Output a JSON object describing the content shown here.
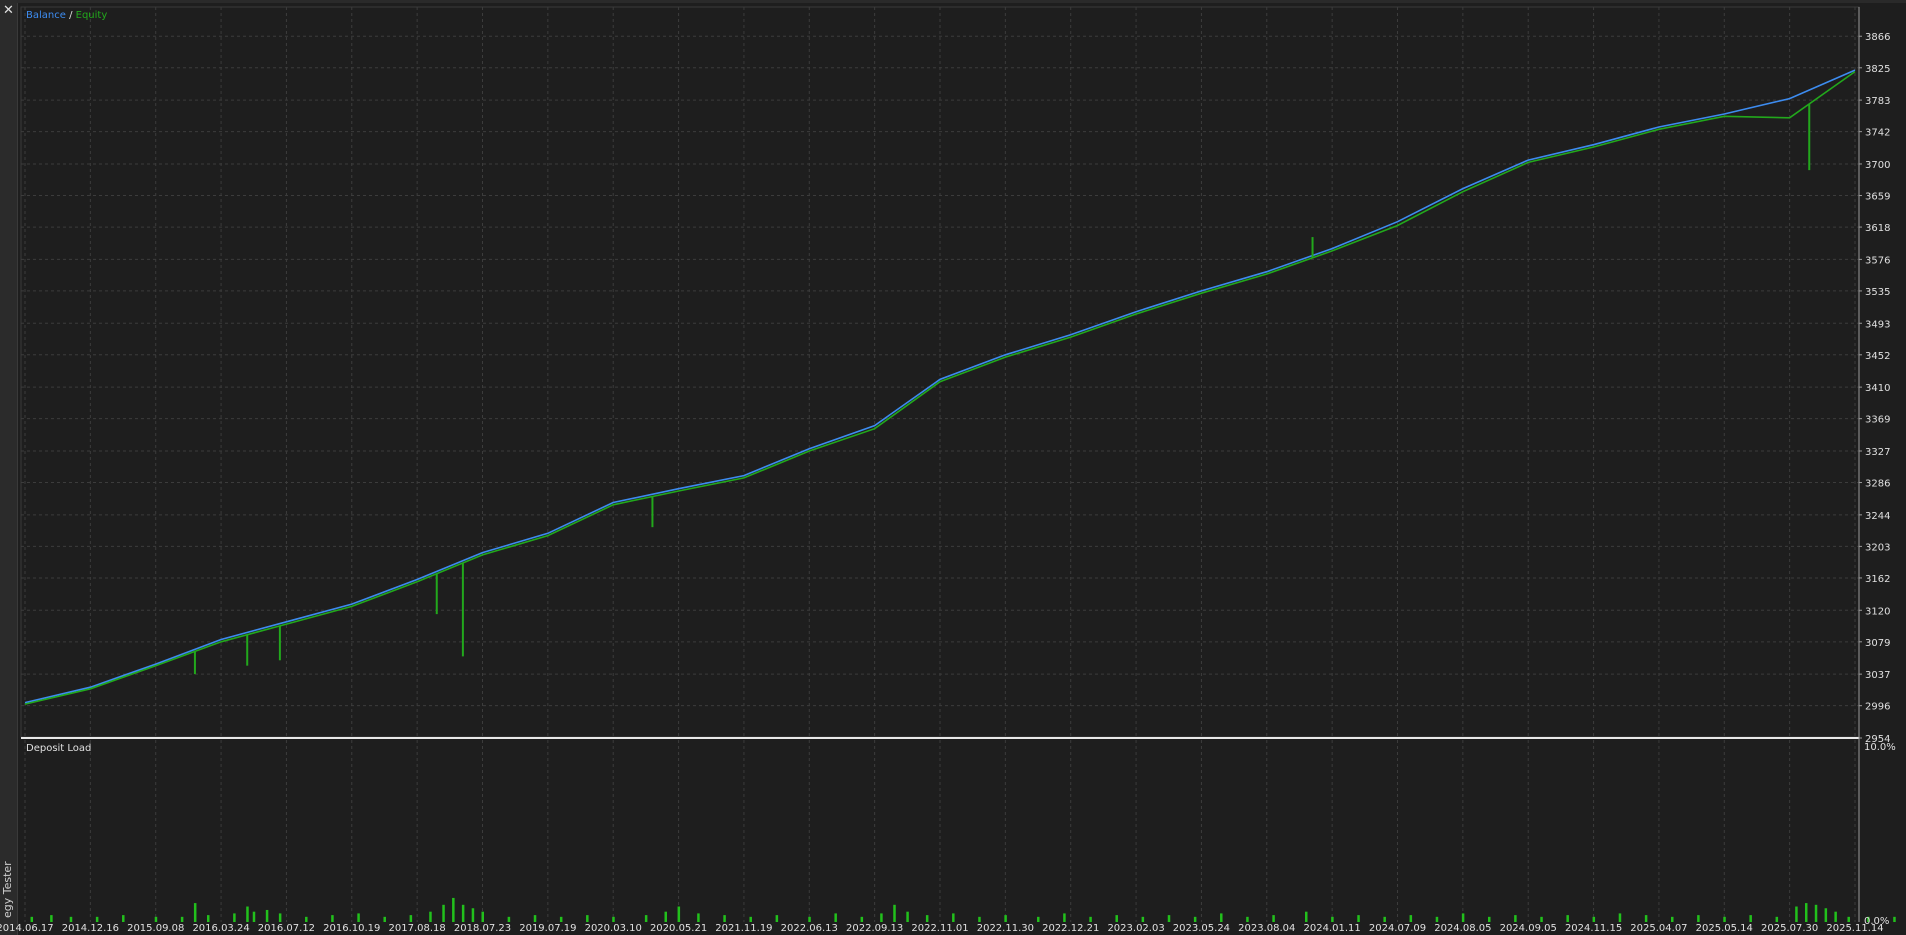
{
  "window": {
    "close_icon": "close-icon",
    "side_label": "egy Tester"
  },
  "colors": {
    "background": "#1e1e1e",
    "grid": "#3c3c3c",
    "balance": "#3d8cf0",
    "equity": "#22a81c",
    "deposit_load": "#22c01c",
    "text": "#e0e0e0",
    "separator": "#e8e8e8"
  },
  "chart_data": [
    {
      "type": "line",
      "legend": {
        "balance": "Balance",
        "separator": " / ",
        "equity": "Equity",
        "position": "top-left"
      },
      "x": [
        "2014.06.17",
        "2014.12.16",
        "2015.09.08",
        "2016.03.24",
        "2016.07.12",
        "2016.10.19",
        "2017.08.18",
        "2018.07.23",
        "2019.07.19",
        "2020.03.10",
        "2020.05.21",
        "2021.11.19",
        "2022.06.13",
        "2022.09.13",
        "2022.11.01",
        "2022.11.30",
        "2022.12.21",
        "2023.02.03",
        "2023.05.24",
        "2023.08.04",
        "2024.01.11",
        "2024.07.09",
        "2024.08.05",
        "2024.09.05",
        "2024.11.15",
        "2025.04.07",
        "2025.05.14",
        "2025.07.30",
        "2025.11.14"
      ],
      "y_ticks": [
        2954,
        2996,
        3037,
        3079,
        3120,
        3162,
        3203,
        3244,
        3286,
        3327,
        3369,
        3410,
        3452,
        3493,
        3535,
        3576,
        3618,
        3659,
        3700,
        3742,
        3783,
        3825,
        3866
      ],
      "ylim": [
        2954,
        3904
      ],
      "grid": true,
      "series": [
        {
          "name": "Balance",
          "values": [
            3000,
            3020,
            3050,
            3082,
            3105,
            3128,
            3160,
            3195,
            3220,
            3260,
            3278,
            3295,
            3330,
            3360,
            3420,
            3452,
            3478,
            3508,
            3535,
            3560,
            3590,
            3625,
            3668,
            3705,
            3725,
            3748,
            3765,
            3785,
            3822
          ]
        },
        {
          "name": "Equity",
          "values": [
            2998,
            3018,
            3048,
            3079,
            3102,
            3125,
            3157,
            3192,
            3217,
            3257,
            3275,
            3292,
            3327,
            3356,
            3417,
            3449,
            3475,
            3505,
            3532,
            3557,
            3587,
            3620,
            3664,
            3702,
            3722,
            3745,
            3762,
            3760,
            3820
          ],
          "drawdowns": [
            {
              "at": 2.6,
              "low": 3037
            },
            {
              "at": 3.4,
              "low": 3048
            },
            {
              "at": 3.9,
              "low": 3055
            },
            {
              "at": 6.3,
              "low": 3115
            },
            {
              "at": 6.7,
              "low": 3060
            },
            {
              "at": 9.6,
              "low": 3228
            },
            {
              "at": 19.7,
              "low": 3605
            },
            {
              "at": 27.3,
              "low": 3692
            }
          ]
        }
      ]
    },
    {
      "type": "bar",
      "title": "Deposit Load",
      "y_ticks": [
        "10.0%",
        "0.0%"
      ],
      "ylim": [
        0,
        10
      ],
      "bars": [
        {
          "at": 0.1,
          "value": 0.3
        },
        {
          "at": 0.4,
          "value": 0.4
        },
        {
          "at": 0.7,
          "value": 0.3
        },
        {
          "at": 1.1,
          "value": 0.3
        },
        {
          "at": 1.5,
          "value": 0.4
        },
        {
          "at": 2.0,
          "value": 0.3
        },
        {
          "at": 2.4,
          "value": 0.3
        },
        {
          "at": 2.6,
          "value": 1.1
        },
        {
          "at": 2.8,
          "value": 0.4
        },
        {
          "at": 3.2,
          "value": 0.5
        },
        {
          "at": 3.4,
          "value": 0.9
        },
        {
          "at": 3.5,
          "value": 0.6
        },
        {
          "at": 3.7,
          "value": 0.7
        },
        {
          "at": 3.9,
          "value": 0.5
        },
        {
          "at": 4.3,
          "value": 0.3
        },
        {
          "at": 4.7,
          "value": 0.4
        },
        {
          "at": 5.1,
          "value": 0.5
        },
        {
          "at": 5.5,
          "value": 0.3
        },
        {
          "at": 5.9,
          "value": 0.4
        },
        {
          "at": 6.2,
          "value": 0.6
        },
        {
          "at": 6.4,
          "value": 1.0
        },
        {
          "at": 6.55,
          "value": 1.4
        },
        {
          "at": 6.7,
          "value": 1.0
        },
        {
          "at": 6.85,
          "value": 0.8
        },
        {
          "at": 7.0,
          "value": 0.6
        },
        {
          "at": 7.4,
          "value": 0.3
        },
        {
          "at": 7.8,
          "value": 0.4
        },
        {
          "at": 8.2,
          "value": 0.3
        },
        {
          "at": 8.6,
          "value": 0.4
        },
        {
          "at": 9.0,
          "value": 0.3
        },
        {
          "at": 9.5,
          "value": 0.4
        },
        {
          "at": 9.8,
          "value": 0.6
        },
        {
          "at": 10.0,
          "value": 0.9
        },
        {
          "at": 10.3,
          "value": 0.5
        },
        {
          "at": 10.7,
          "value": 0.4
        },
        {
          "at": 11.1,
          "value": 0.3
        },
        {
          "at": 11.5,
          "value": 0.4
        },
        {
          "at": 12.0,
          "value": 0.3
        },
        {
          "at": 12.4,
          "value": 0.5
        },
        {
          "at": 12.8,
          "value": 0.3
        },
        {
          "at": 13.1,
          "value": 0.5
        },
        {
          "at": 13.3,
          "value": 1.0
        },
        {
          "at": 13.5,
          "value": 0.6
        },
        {
          "at": 13.8,
          "value": 0.4
        },
        {
          "at": 14.2,
          "value": 0.5
        },
        {
          "at": 14.6,
          "value": 0.3
        },
        {
          "at": 15.0,
          "value": 0.4
        },
        {
          "at": 15.5,
          "value": 0.3
        },
        {
          "at": 15.9,
          "value": 0.5
        },
        {
          "at": 16.3,
          "value": 0.3
        },
        {
          "at": 16.7,
          "value": 0.4
        },
        {
          "at": 17.1,
          "value": 0.3
        },
        {
          "at": 17.5,
          "value": 0.4
        },
        {
          "at": 17.9,
          "value": 0.3
        },
        {
          "at": 18.3,
          "value": 0.5
        },
        {
          "at": 18.7,
          "value": 0.3
        },
        {
          "at": 19.1,
          "value": 0.4
        },
        {
          "at": 19.6,
          "value": 0.6
        },
        {
          "at": 20.0,
          "value": 0.3
        },
        {
          "at": 20.4,
          "value": 0.4
        },
        {
          "at": 20.8,
          "value": 0.3
        },
        {
          "at": 21.2,
          "value": 0.4
        },
        {
          "at": 21.6,
          "value": 0.3
        },
        {
          "at": 22.0,
          "value": 0.5
        },
        {
          "at": 22.4,
          "value": 0.3
        },
        {
          "at": 22.8,
          "value": 0.4
        },
        {
          "at": 23.2,
          "value": 0.3
        },
        {
          "at": 23.6,
          "value": 0.4
        },
        {
          "at": 24.0,
          "value": 0.3
        },
        {
          "at": 24.4,
          "value": 0.5
        },
        {
          "at": 24.8,
          "value": 0.4
        },
        {
          "at": 25.2,
          "value": 0.3
        },
        {
          "at": 25.6,
          "value": 0.4
        },
        {
          "at": 26.0,
          "value": 0.3
        },
        {
          "at": 26.4,
          "value": 0.4
        },
        {
          "at": 26.8,
          "value": 0.3
        },
        {
          "at": 27.1,
          "value": 0.9
        },
        {
          "at": 27.25,
          "value": 1.1
        },
        {
          "at": 27.4,
          "value": 1.0
        },
        {
          "at": 27.55,
          "value": 0.8
        },
        {
          "at": 27.7,
          "value": 0.6
        },
        {
          "at": 27.9,
          "value": 0.3
        },
        {
          "at": 28.2,
          "value": 0.3
        },
        {
          "at": 28.6,
          "value": 0.3
        }
      ]
    }
  ]
}
